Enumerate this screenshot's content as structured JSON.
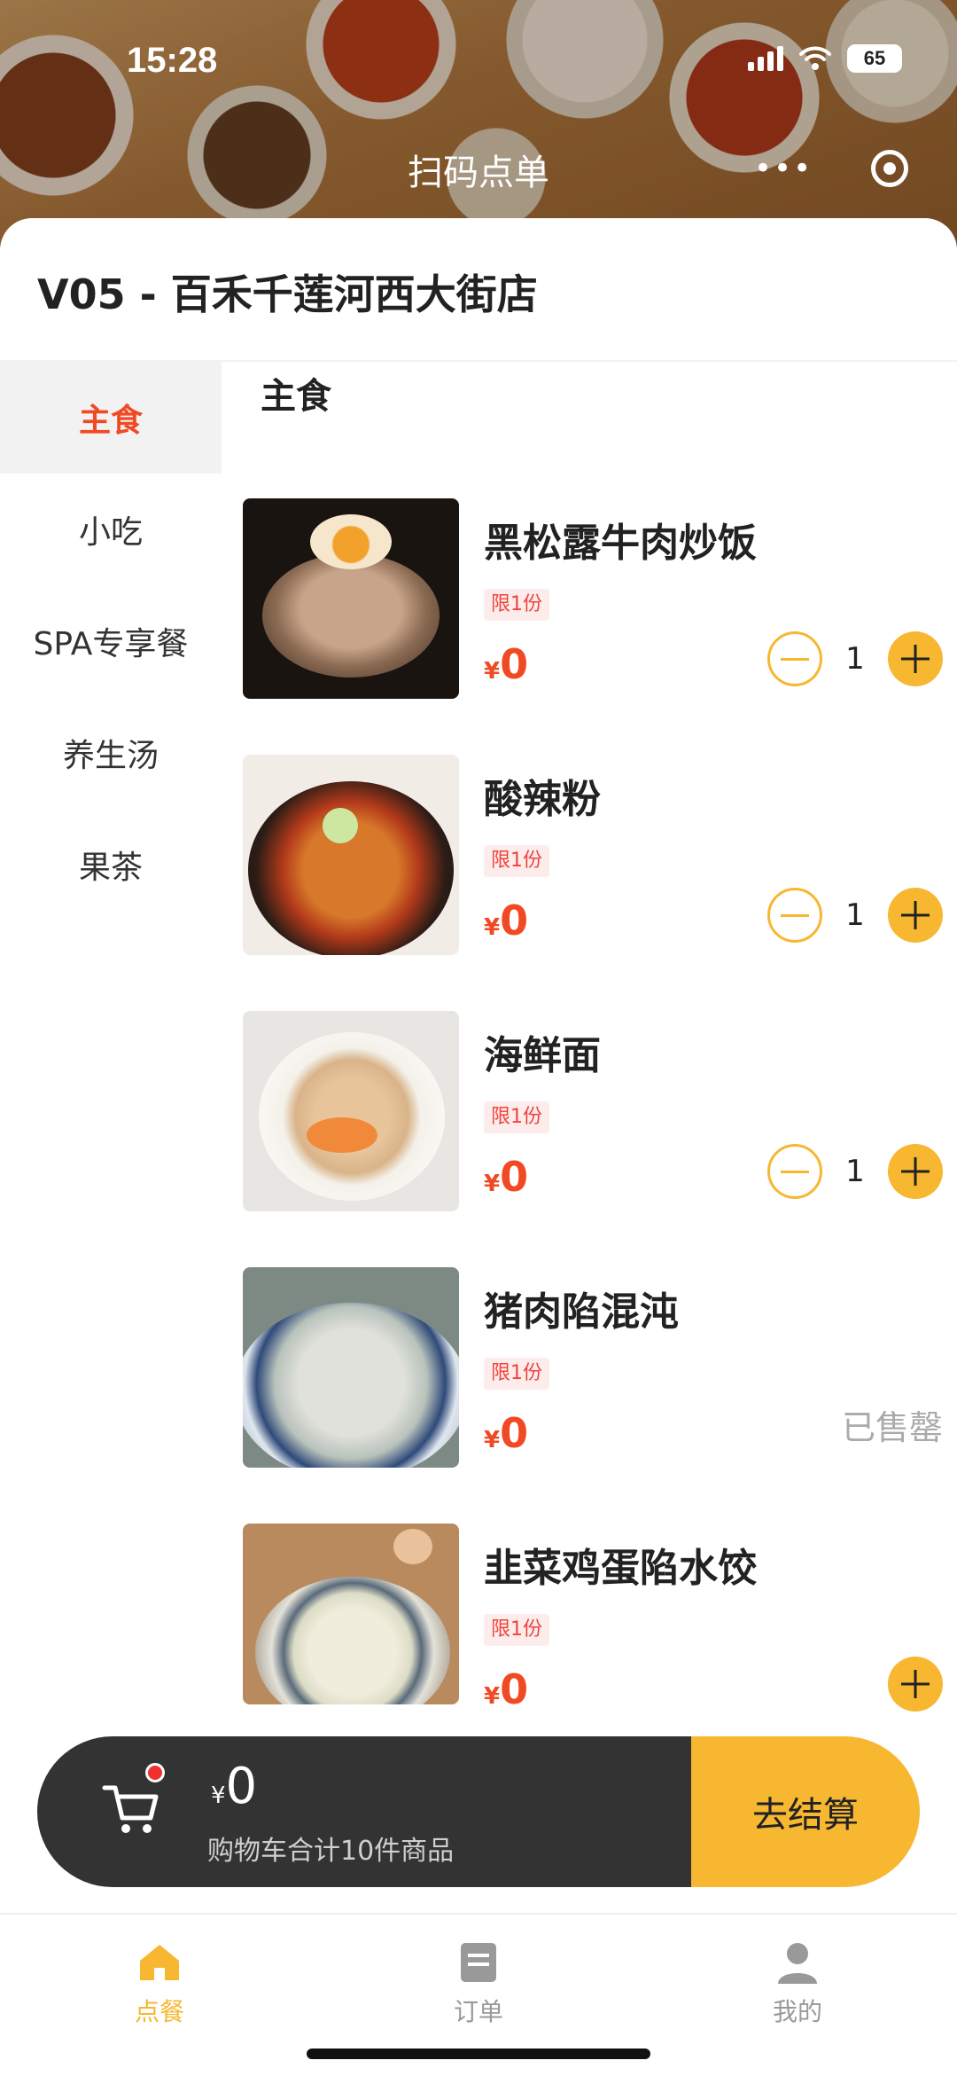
{
  "status_bar": {
    "time": "15:28",
    "battery": "65"
  },
  "nav": {
    "title": "扫码点单"
  },
  "store": {
    "name": "V05 - 百禾千莲河西大街店"
  },
  "categories": [
    {
      "label": "主食",
      "active": true
    },
    {
      "label": "小吃"
    },
    {
      "label": "SPA专享餐"
    },
    {
      "label": "养生汤"
    },
    {
      "label": "果茶"
    }
  ],
  "section_title": "主食",
  "items": [
    {
      "name": "黑松露牛肉炒饭",
      "limit": "限1份",
      "currency": "¥",
      "price": "0",
      "qty": "1"
    },
    {
      "name": "酸辣粉",
      "limit": "限1份",
      "currency": "¥",
      "price": "0",
      "qty": "1"
    },
    {
      "name": "海鲜面",
      "limit": "限1份",
      "currency": "¥",
      "price": "0",
      "qty": "1"
    },
    {
      "name": "猪肉陷混沌",
      "limit": "限1份",
      "currency": "¥",
      "price": "0",
      "status": "已售罄"
    },
    {
      "name": "韭菜鸡蛋陷水饺",
      "limit": "限1份",
      "currency": "¥",
      "price": "0"
    }
  ],
  "cart": {
    "currency": "¥",
    "total": "0",
    "summary": "购物车合计10件商品",
    "checkout_label": "去结算"
  },
  "tabbar": [
    {
      "label": "点餐",
      "icon": "home-icon",
      "active": true
    },
    {
      "label": "订单",
      "icon": "order-icon"
    },
    {
      "label": "我的",
      "icon": "user-icon"
    }
  ],
  "colors": {
    "accent": "#f7b731",
    "price": "#f04a24",
    "dark": "#333333"
  }
}
